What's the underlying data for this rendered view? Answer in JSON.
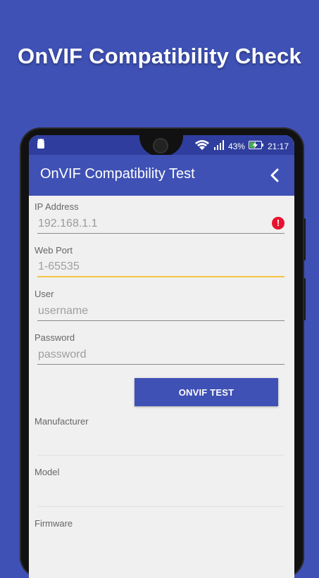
{
  "headline": "OnVIF Compatibility Check",
  "status": {
    "battery": "43%",
    "time": "21:17"
  },
  "appbar": {
    "title": "OnVIF Compatibility Test"
  },
  "form": {
    "ip": {
      "label": "IP Address",
      "value": "192.168.1.1",
      "error_icon": "!"
    },
    "port": {
      "label": "Web Port",
      "placeholder": "1-65535"
    },
    "user": {
      "label": "User",
      "placeholder": "username"
    },
    "password": {
      "label": "Password",
      "placeholder": "password"
    },
    "button": "ONVIF TEST"
  },
  "results": {
    "manufacturer": "Manufacturer",
    "model": "Model",
    "firmware": "Firmware"
  },
  "colors": {
    "primary": "#3f51b5",
    "status_bar": "#2f3e9e",
    "error": "#e8112d",
    "focus": "#f5c542"
  }
}
